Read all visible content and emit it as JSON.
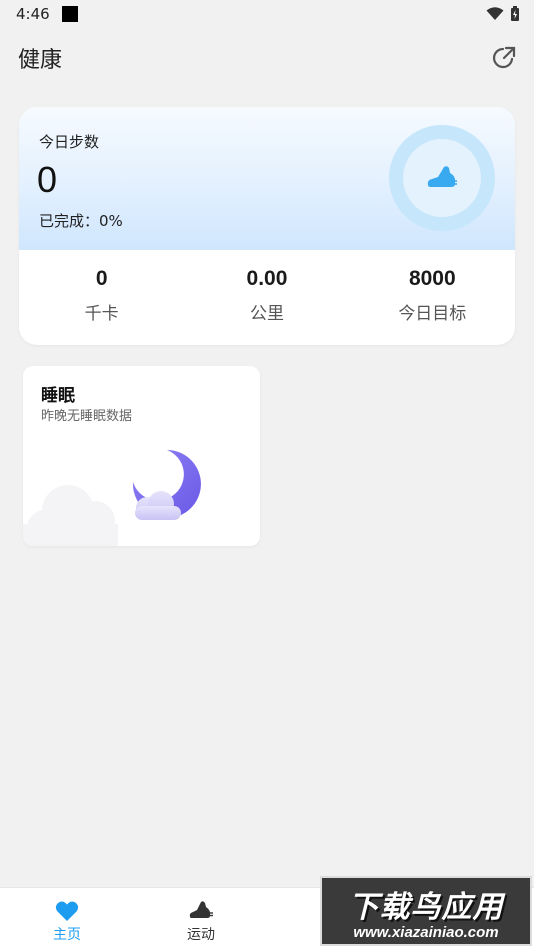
{
  "status_bar": {
    "time": "4:46"
  },
  "app_bar": {
    "title": "健康"
  },
  "steps_card": {
    "label": "今日步数",
    "value": "0",
    "completed": "已完成：0%",
    "stats": [
      {
        "value": "0",
        "label": "千卡"
      },
      {
        "value": "0.00",
        "label": "公里"
      },
      {
        "value": "8000",
        "label": "今日目标"
      }
    ]
  },
  "sleep_card": {
    "title": "睡眠",
    "subtitle": "昨晚无睡眠数据"
  },
  "bottom_nav": {
    "items": [
      {
        "label": "主页",
        "icon": "heart-icon",
        "active": true
      },
      {
        "label": "运动",
        "icon": "shoe-icon",
        "active": false
      }
    ]
  },
  "watermark": {
    "title": "下载鸟应用",
    "url": "www.xiazainiao.com"
  },
  "colors": {
    "accent": "#1e9cf0",
    "moon": "#7b6cf0",
    "ring": "#c6e6fb"
  }
}
